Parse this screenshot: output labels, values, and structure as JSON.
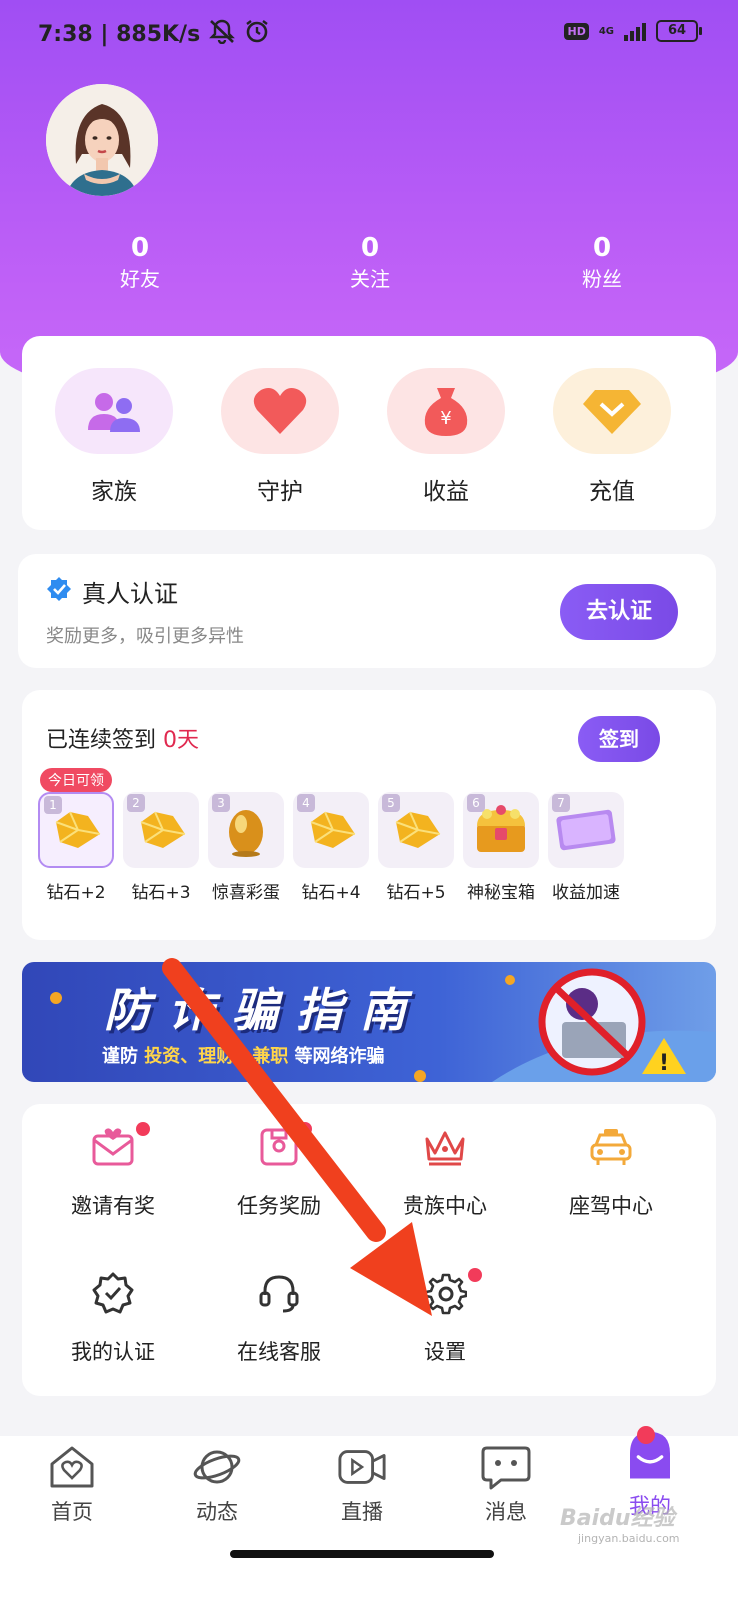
{
  "status_bar": {
    "time_speed": "7:38 | 885K/s",
    "hd": "HD",
    "network": "4G",
    "battery": "64"
  },
  "profile": {
    "stats": [
      {
        "value": "0",
        "label": "好友"
      },
      {
        "value": "0",
        "label": "关注"
      },
      {
        "value": "0",
        "label": "粉丝"
      }
    ]
  },
  "quick_actions": [
    {
      "label": "家族",
      "icon": "family-icon"
    },
    {
      "label": "守护",
      "icon": "heart-icon"
    },
    {
      "label": "收益",
      "icon": "money-bag-icon"
    },
    {
      "label": "充值",
      "icon": "diamond-icon"
    }
  ],
  "verification": {
    "title": "真人认证",
    "subtitle": "奖励更多，吸引更多异性",
    "button": "去认证"
  },
  "sign_in": {
    "title_prefix": "已连续签到 ",
    "days": "0天",
    "button": "签到",
    "today_tag": "今日可领",
    "rewards": [
      {
        "num": "1",
        "label": "钻石+2",
        "type": "diamond"
      },
      {
        "num": "2",
        "label": "钻石+3",
        "type": "diamond"
      },
      {
        "num": "3",
        "label": "惊喜彩蛋",
        "type": "egg"
      },
      {
        "num": "4",
        "label": "钻石+4",
        "type": "diamond"
      },
      {
        "num": "5",
        "label": "钻石+5",
        "type": "diamond"
      },
      {
        "num": "6",
        "label": "神秘宝箱",
        "type": "chest"
      },
      {
        "num": "7",
        "label": "收益加速",
        "type": "ticket"
      }
    ]
  },
  "banner": {
    "title": "防诈骗指南",
    "sub_prefix": "谨防 ",
    "sub_highlight_1": "投资、理财、兼职",
    "sub_suffix": " 等网络诈骗"
  },
  "menu": [
    {
      "label": "邀请有奖",
      "icon": "invite-envelope-icon",
      "dot": true
    },
    {
      "label": "任务奖励",
      "icon": "task-reward-icon",
      "dot": true
    },
    {
      "label": "贵族中心",
      "icon": "crown-icon",
      "dot": false
    },
    {
      "label": "座驾中心",
      "icon": "car-icon",
      "dot": false
    },
    {
      "label": "我的认证",
      "icon": "verified-badge-icon",
      "dot": false
    },
    {
      "label": "在线客服",
      "icon": "headset-icon",
      "dot": false
    },
    {
      "label": "设置",
      "icon": "gear-icon",
      "dot": true
    }
  ],
  "tabbar": [
    {
      "label": "首页",
      "icon": "home-icon"
    },
    {
      "label": "动态",
      "icon": "planet-icon"
    },
    {
      "label": "直播",
      "icon": "video-icon"
    },
    {
      "label": "消息",
      "icon": "message-icon"
    },
    {
      "label": "我的",
      "icon": "profile-mascot-icon"
    }
  ],
  "watermark": {
    "main": "Baidu经验",
    "sub": "jingyan.baidu.com"
  },
  "colors": {
    "accent": "#8a4bf0",
    "header": "#b05cf5",
    "alert": "#f23b5a",
    "arrow": "#f0401e"
  }
}
